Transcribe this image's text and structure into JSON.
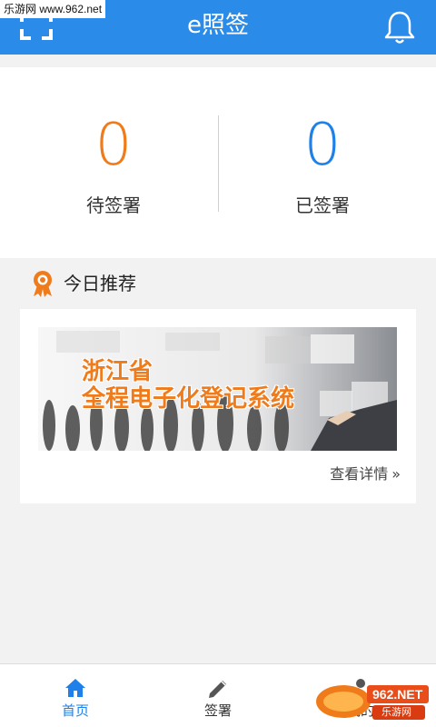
{
  "watermark": {
    "top_text": "乐游网 www.962.net",
    "bottom_text": "962.NET",
    "bottom_sub": "乐游网"
  },
  "header": {
    "title": "e照签",
    "scan_icon": "scan-icon",
    "notify_icon": "bell-icon"
  },
  "stats": {
    "pending": {
      "value": "0",
      "label": "待签署"
    },
    "signed": {
      "value": "0",
      "label": "已签署"
    }
  },
  "recommend": {
    "title": "今日推荐",
    "banner_line1": "浙江省",
    "banner_line2": "全程电子化登记系统",
    "detail_label": "查看详情",
    "detail_chevron": "»"
  },
  "tabs": [
    {
      "label": "首页",
      "icon": "home-icon",
      "active": true
    },
    {
      "label": "签署",
      "icon": "pencil-icon",
      "active": false
    },
    {
      "label": "我的",
      "icon": "user-icon",
      "active": false
    }
  ],
  "colors": {
    "brand": "#2b8be9",
    "pending": "#f07b1b",
    "signed": "#1e80e8",
    "accent": "#f07b1b"
  }
}
